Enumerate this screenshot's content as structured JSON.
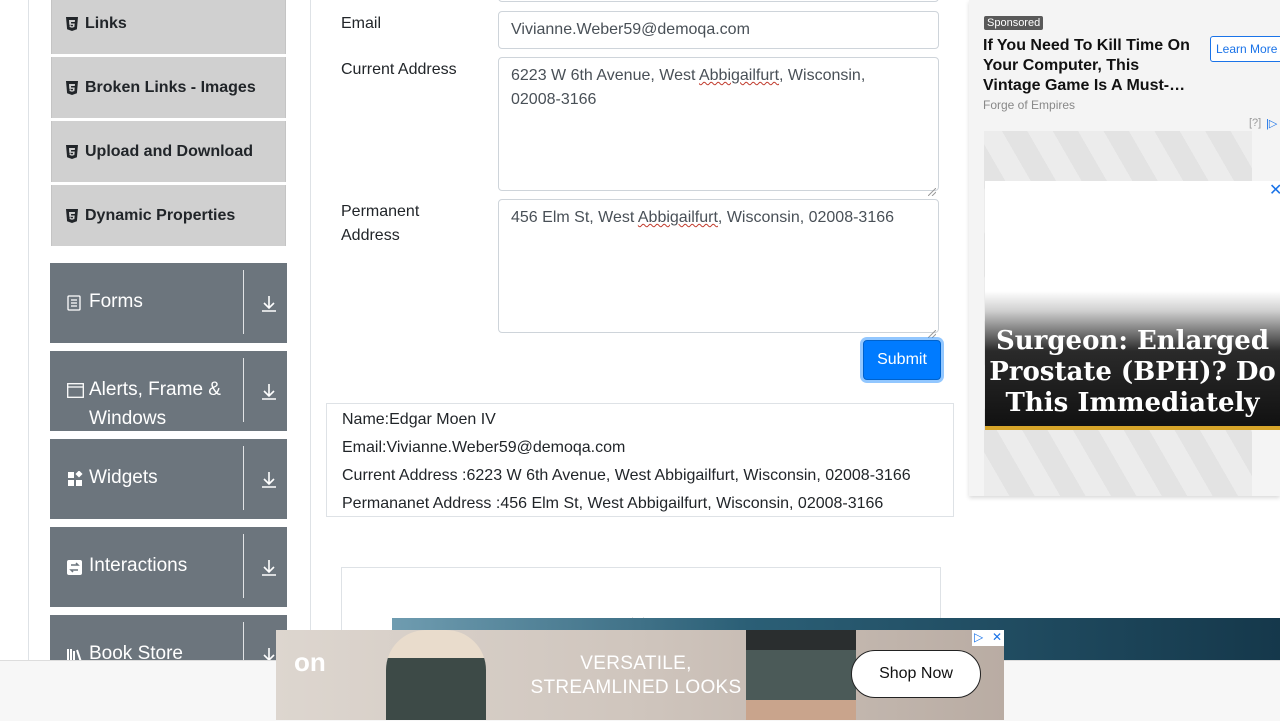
{
  "sidebar": {
    "items": [
      {
        "label": "Links",
        "icon": "html5-icon"
      },
      {
        "label": "Broken Links - Images",
        "icon": "html5-icon"
      },
      {
        "label": "Upload and Download",
        "icon": "html5-icon"
      },
      {
        "label": "Dynamic Properties",
        "icon": "html5-icon"
      }
    ],
    "groups": [
      {
        "label": "Forms",
        "icon": "form-icon"
      },
      {
        "label": "Alerts, Frame &",
        "label2": "Windows",
        "icon": "window-icon"
      },
      {
        "label": "Widgets",
        "icon": "widgets-icon"
      },
      {
        "label": "Interactions",
        "icon": "interactions-icon"
      },
      {
        "label": "Book Store",
        "icon": "book-icon"
      }
    ]
  },
  "form": {
    "email_label": "Email",
    "email_value": "Vivianne.Weber59@demoqa.com",
    "current_address_label": "Current Address",
    "current_address_pre": "6223 W 6th Avenue, West ",
    "current_address_squig": "Abbigailfurt",
    "current_address_post": ", Wisconsin,",
    "current_address_line2": "02008-3166",
    "permanent_address_label": "Permanent",
    "permanent_address_label2": "Address",
    "permanent_address_pre": "456 Elm St, West ",
    "permanent_address_squig": "Abbigailfurt",
    "permanent_address_post": ", Wisconsin, 02008-3166",
    "submit_label": "Submit"
  },
  "output": {
    "name": "Name:Edgar Moen IV",
    "email": "Email:Vivianne.Weber59@demoqa.com",
    "current_address": "Current Address :6223 W 6th Avenue, West Abbigailfurt, Wisconsin, 02008-3166",
    "permanent_address": "Permananet Address :456 Elm St, West Abbigailfurt, Wisconsin, 02008-3166"
  },
  "ads": {
    "sponsored": "Sponsored",
    "native_title": "If You Need To Kill Time On Your Computer, This Vintage Game Is A Must-…",
    "native_source": "Forge of Empires",
    "learn_more": "Learn More",
    "ad_q": "[?]",
    "display_text": "Surgeon: Enlarged Prostate (BPH)? Do This Immediately",
    "banner_brand": "on",
    "banner_line1": "VERSATILE,",
    "banner_line2": "STREAMLINED LOOKS",
    "banner_cta": "Shop Now"
  },
  "colors": {
    "primary": "#007bff",
    "group_bg": "#6c757d",
    "item_bg": "#d0d0d0"
  }
}
